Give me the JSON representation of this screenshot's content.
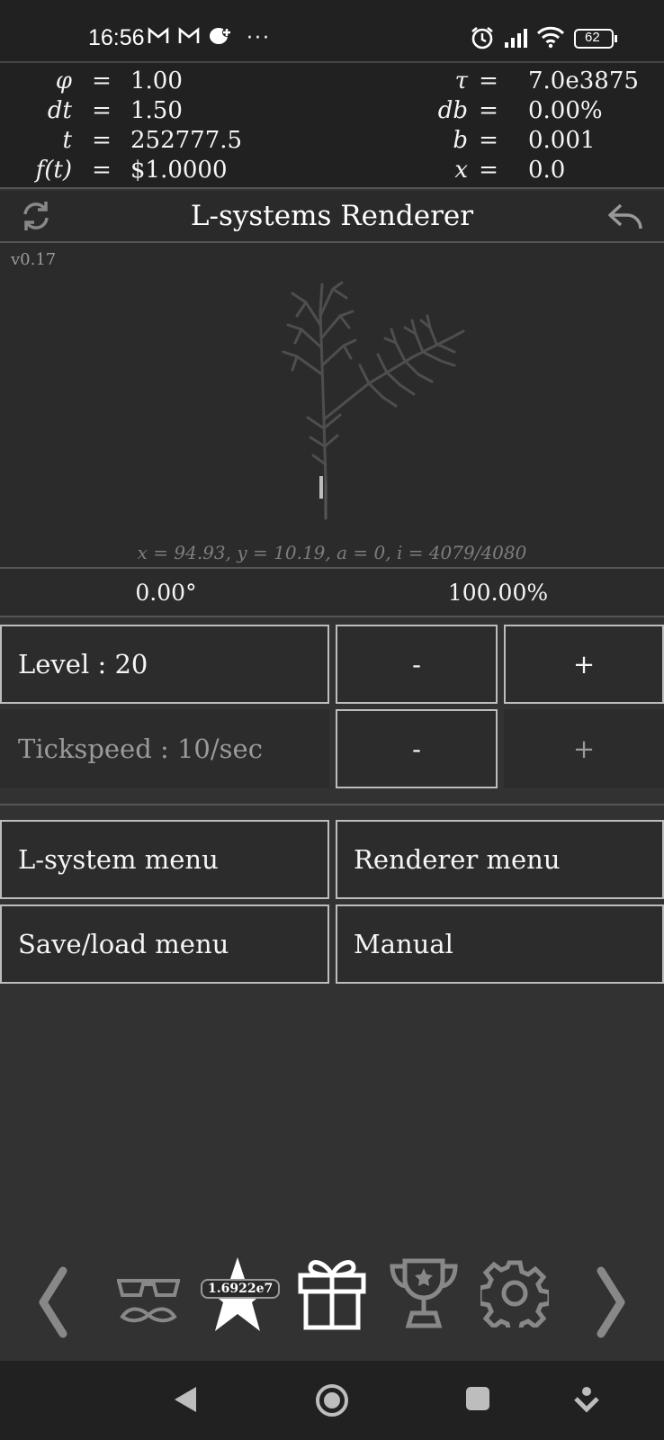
{
  "status_bar": {
    "time": "16:56",
    "more": "···",
    "battery": "62",
    "icons": [
      "gmail-icon",
      "gmail-icon",
      "chat-notification-icon",
      "alarm-icon",
      "signal-icon",
      "wifi-icon",
      "battery-icon"
    ]
  },
  "equations": {
    "left": [
      {
        "sym": "φ",
        "val": "1.00"
      },
      {
        "sym": "dt",
        "val": "1.50"
      },
      {
        "sym": "t",
        "val": "252777.5"
      },
      {
        "sym": "f(t)",
        "val": "$1.0000"
      }
    ],
    "right": [
      {
        "sym": "τ",
        "val": "7.0e3875"
      },
      {
        "sym": "db",
        "val": "0.00%"
      },
      {
        "sym": "b",
        "val": "0.001"
      },
      {
        "sym": "x",
        "val": "0.0"
      }
    ],
    "equals": "="
  },
  "header": {
    "title": "L-systems Renderer",
    "left_icon": "refresh-icon",
    "right_icon": "back-arrow-icon"
  },
  "canvas": {
    "version": "v0.17",
    "coords": "x = 94.93,   y = 10.19,   a = 0,   i = 4079/4080"
  },
  "angle_row": {
    "angle": "0.00°",
    "zoom": "100.00%"
  },
  "level": {
    "label": "Level :  20",
    "minus": "-",
    "plus": "+"
  },
  "tickspeed": {
    "label": "Tickspeed :  10/sec",
    "minus": "-",
    "plus": "+"
  },
  "menus": {
    "lsystem": "L-system menu",
    "renderer": "Renderer menu",
    "saveload": "Save/load menu",
    "manual": "Manual"
  },
  "bottom_nav": {
    "star_badge": "1.6922e7",
    "icons": [
      "chevron-left-icon",
      "disguise-glasses-icon",
      "star-icon",
      "gift-icon",
      "trophy-icon",
      "gear-icon",
      "chevron-right-icon"
    ]
  },
  "system_nav": {
    "icons": [
      "nav-back-icon",
      "nav-home-icon",
      "nav-recents-icon",
      "nav-assist-icon"
    ]
  }
}
